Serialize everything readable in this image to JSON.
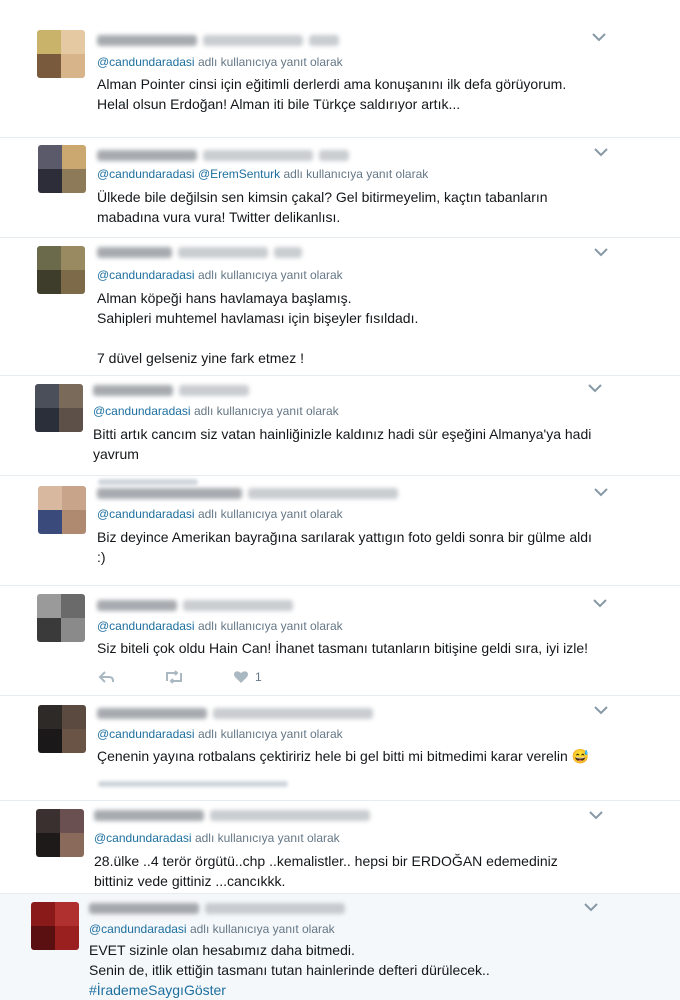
{
  "reply_suffix": "adlı kullanıcıya yanıt olarak",
  "colors": {
    "accent": "#1d6f9f",
    "muted": "#657786",
    "text": "#14171a",
    "highlight_bg": "#f5f8fa",
    "icon": "#aab8c2"
  },
  "tweets": [
    {
      "reply_to": [
        "@candundaradasi"
      ],
      "lines": [
        "Alman Pointer cinsi için eğitimli derlerdi ama konuşanını ilk defa görüyorum.",
        "Helal olsun Erdoğan! Alman iti bile Türkçe saldırıyor artık..."
      ]
    },
    {
      "reply_to": [
        "@candundaradasi",
        "@EremSenturk"
      ],
      "lines": [
        "Ülkede bile değilsin sen kimsin çakal? Gel bitirmeyelim, kaçtın tabanların",
        "mabadına vura vura! Twitter delikanlısı."
      ]
    },
    {
      "reply_to": [
        "@candundaradasi"
      ],
      "lines": [
        "Alman köpeği hans havlamaya başlamış.",
        "Sahipleri muhtemel havlaması için bişeyler fısıldadı.",
        "",
        "7 düvel gelseniz yine fark etmez !"
      ]
    },
    {
      "reply_to": [
        "@candundaradasi"
      ],
      "lines": [
        "Bitti artık cancım siz vatan hainliğinizle kaldınız hadi sür eşeğini Almanya'ya hadi",
        "yavrum"
      ]
    },
    {
      "reply_to": [
        "@candundaradasi"
      ],
      "lines": [
        "Biz deyince Amerikan bayrağına sarılarak yattıgın foto geldi sonra bir gülme aldı",
        ":)"
      ]
    },
    {
      "reply_to": [
        "@candundaradasi"
      ],
      "lines": [
        "Siz biteli çok oldu Hain Can! İhanet tasmanı tutanların bitişine geldi sıra, iyi izle!"
      ],
      "like_count": "1"
    },
    {
      "reply_to": [
        "@candundaradasi"
      ],
      "lines": [
        "Çenenin yayına rotbalans çektiririz hele bi gel bitti mi bitmedimi karar verelin 😅"
      ]
    },
    {
      "reply_to": [
        "@candundaradasi"
      ],
      "lines": [
        "28.ülke ..4 terör örgütü..chp ..kemalistler.. hepsi bir ERDOĞAN edemediniz",
        "bittiniz vede gittiniz ...cancıkkk."
      ]
    },
    {
      "reply_to": [
        "@candundaradasi"
      ],
      "lines": [
        "EVET sizinle olan hesabımız daha bitmedi.",
        "Senin de, itlik ettiğin tasmanı tutan hainlerinde defteri dürülecek.."
      ],
      "hashtag": "#İrademeSaygıGöster"
    }
  ]
}
